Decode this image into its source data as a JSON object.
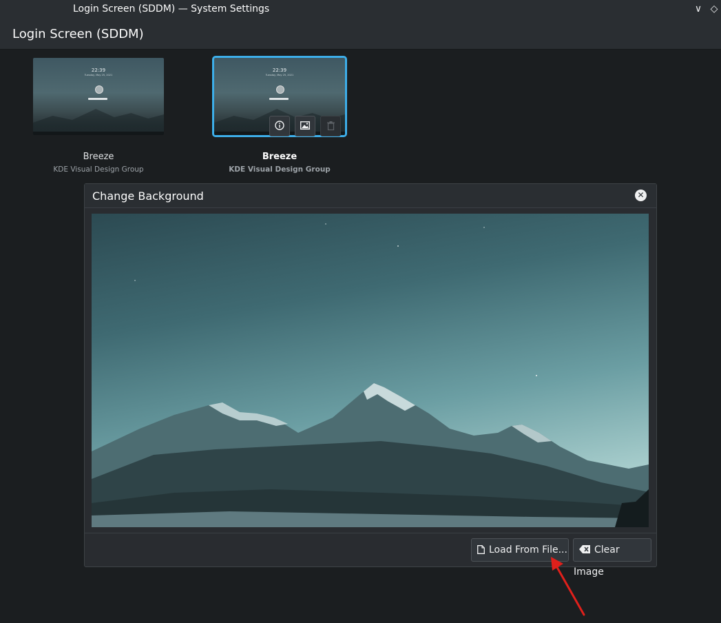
{
  "window": {
    "title": "Login Screen (SDDM) — System Settings",
    "minimize_glyph": "∨",
    "keep_above_glyph": "◇"
  },
  "header": {
    "title": "Login Screen (SDDM)"
  },
  "themes": [
    {
      "name": "Breeze",
      "author": "KDE Visual Design Group",
      "clock": "22:39",
      "date": "Tuesday, May 25, 2021",
      "selected": false
    },
    {
      "name": "Breeze",
      "author": "KDE Visual Design Group",
      "clock": "22:39",
      "date": "Tuesday, May 25, 2021",
      "selected": true
    }
  ],
  "theme_actions": {
    "info_icon": "info-icon",
    "background_icon": "image-icon",
    "delete_icon": "trash-icon"
  },
  "dialog": {
    "title": "Change Background",
    "load_label": "Load From File...",
    "clear_label": "Clear Image"
  },
  "colors": {
    "accent": "#3daee9",
    "window_bg": "#1b1e20",
    "header_bg": "#2a2e32",
    "annotation_arrow": "#e0201b"
  }
}
